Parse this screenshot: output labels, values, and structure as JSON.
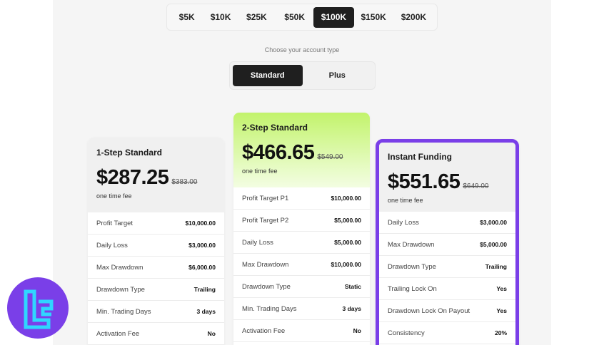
{
  "amounts": {
    "options": [
      "$5K",
      "$10K",
      "$25K",
      "$50K",
      "$100K",
      "$150K",
      "$200K"
    ],
    "selected_index": 4
  },
  "account_type": {
    "caption": "Choose your account type",
    "options": [
      "Standard",
      "Plus"
    ],
    "selected": "Standard"
  },
  "cards": [
    {
      "title": "1-Step Standard",
      "price": "$287.25",
      "old_price": "$383.00",
      "fee_label": "one time fee",
      "rows": [
        {
          "label": "Profit Target",
          "value": "$10,000.00"
        },
        {
          "label": "Daily Loss",
          "value": "$3,000.00"
        },
        {
          "label": "Max Drawdown",
          "value": "$6,000.00"
        },
        {
          "label": "Drawdown Type",
          "value": "Trailing"
        },
        {
          "label": "Min. Trading Days",
          "value": "3 days"
        },
        {
          "label": "Activation Fee",
          "value": "No"
        }
      ]
    },
    {
      "title": "2-Step Standard",
      "price": "$466.65",
      "old_price": "$549.00",
      "fee_label": "one time fee",
      "rows": [
        {
          "label": "Profit Target P1",
          "value": "$10,000.00"
        },
        {
          "label": "Profit Target P2",
          "value": "$5,000.00"
        },
        {
          "label": "Daily Loss",
          "value": "$5,000.00"
        },
        {
          "label": "Max Drawdown",
          "value": "$10,000.00"
        },
        {
          "label": "Drawdown Type",
          "value": "Static"
        },
        {
          "label": "Min. Trading Days",
          "value": "3 days"
        },
        {
          "label": "Activation Fee",
          "value": "No"
        }
      ]
    },
    {
      "title": "Instant Funding",
      "price": "$551.65",
      "old_price": "$649.00",
      "fee_label": "one time fee",
      "rows": [
        {
          "label": "Daily Loss",
          "value": "$3,000.00"
        },
        {
          "label": "Max Drawdown",
          "value": "$5,000.00"
        },
        {
          "label": "Drawdown Type",
          "value": "Trailing"
        },
        {
          "label": "Trailing Lock On",
          "value": "Yes"
        },
        {
          "label": "Drawdown Lock On Payout",
          "value": "Yes"
        },
        {
          "label": "Consistency",
          "value": "20%"
        }
      ]
    }
  ],
  "colors": {
    "accent": "#7a3fe8",
    "highlight_green": "#c2f36b",
    "dark": "#1f1f1f",
    "logo_stroke": "#2fd6ff"
  },
  "logo": {
    "icon": "brand-logo-icon"
  }
}
